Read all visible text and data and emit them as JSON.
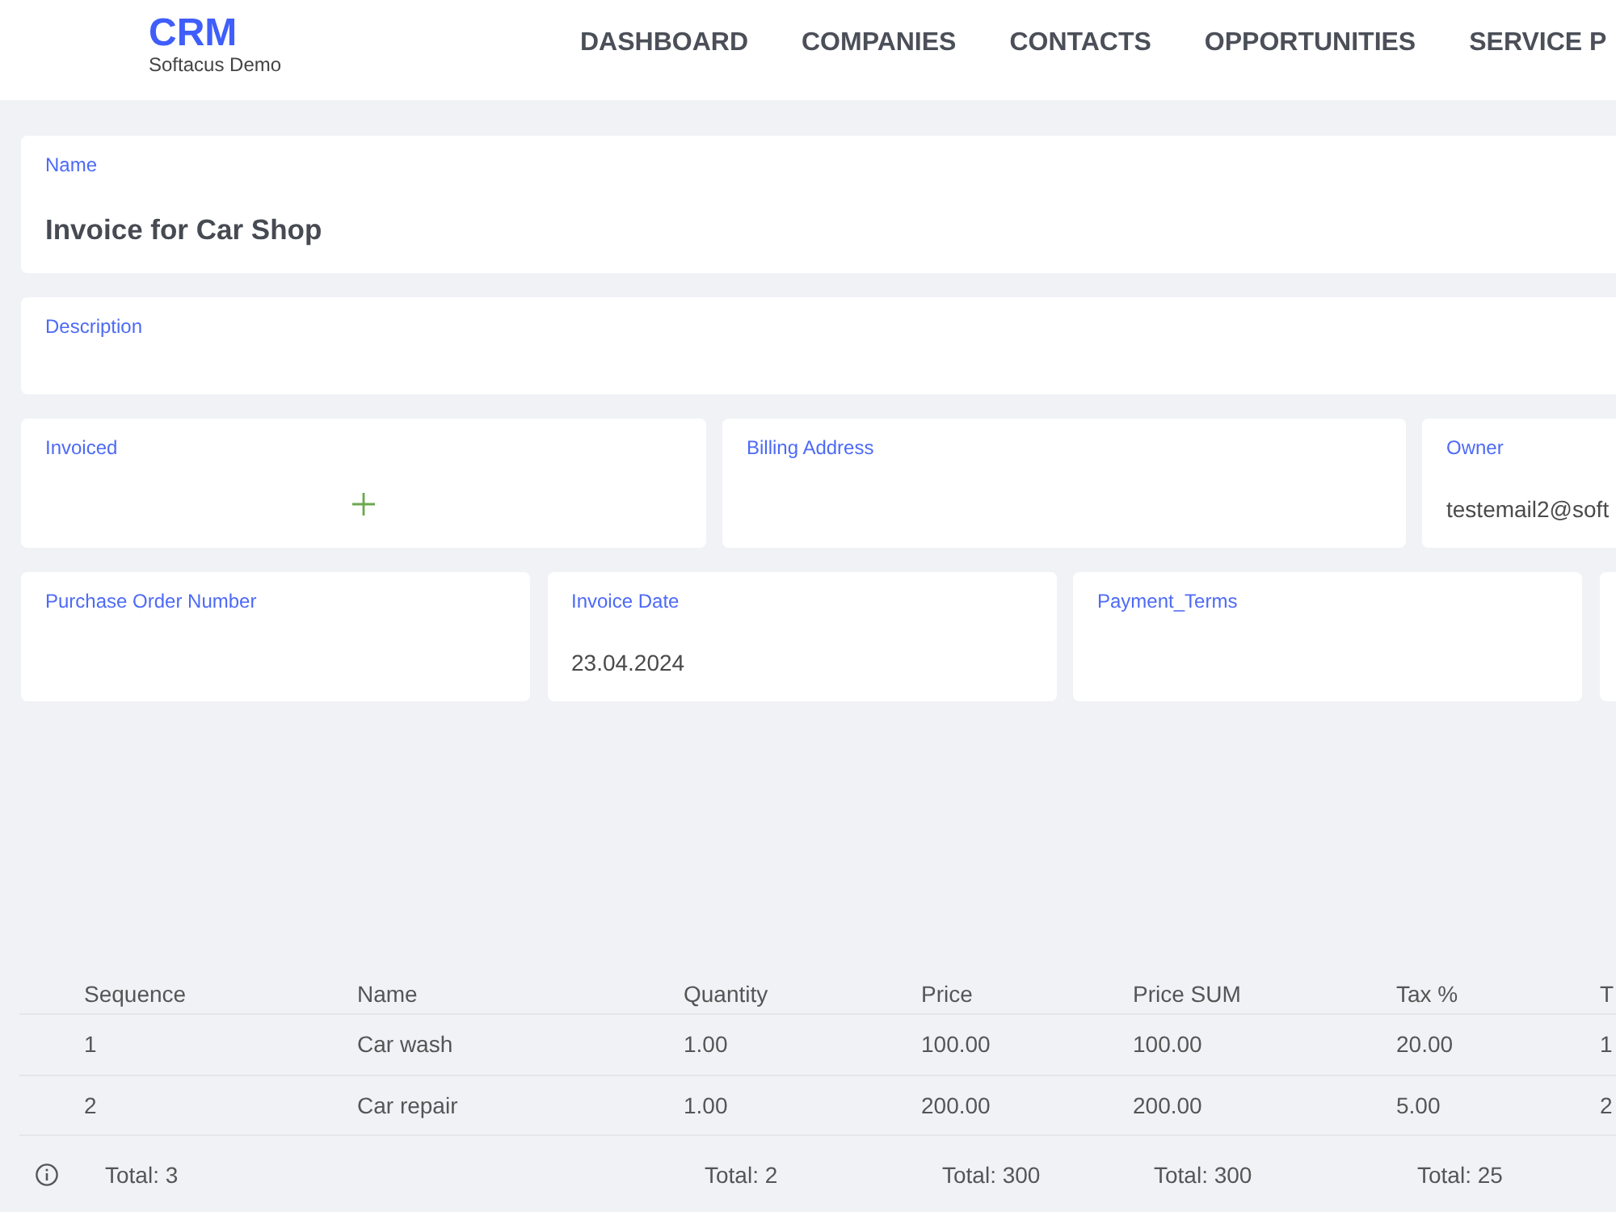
{
  "header": {
    "logo": "CRM",
    "subtitle": "Softacus Demo",
    "nav": [
      {
        "label": "DASHBOARD"
      },
      {
        "label": "COMPANIES"
      },
      {
        "label": "CONTACTS"
      },
      {
        "label": "OPPORTUNITIES"
      },
      {
        "label": "SERVICE P"
      }
    ]
  },
  "form": {
    "rows": [
      [
        {
          "kind": "title",
          "label": "Name",
          "value": "Invoice for Car Shop"
        }
      ],
      [
        {
          "kind": "text",
          "label": "Description"
        }
      ],
      [
        {
          "kind": "add",
          "label": "Invoiced"
        },
        {
          "kind": "text",
          "label": "Billing Address"
        },
        {
          "kind": "text",
          "label": "Owner",
          "value": "testemail2@soft"
        }
      ],
      [
        {
          "kind": "text",
          "label": "Purchase Order Number"
        },
        {
          "kind": "text",
          "label": "Invoice Date",
          "value": "23.04.2024"
        },
        {
          "kind": "text",
          "label": "Payment_Terms"
        },
        {
          "kind": "blank"
        }
      ]
    ]
  },
  "table": {
    "columns": [
      "Sequence",
      "Name",
      "Quantity",
      "Price",
      "Price SUM",
      "Tax %",
      "T"
    ],
    "rows": [
      [
        "1",
        "Car wash",
        "1.00",
        "100.00",
        "100.00",
        "20.00",
        "1"
      ],
      [
        "2",
        "Car repair",
        "1.00",
        "200.00",
        "200.00",
        "5.00",
        "2"
      ]
    ],
    "totals": {
      "sequence": "Total: 3",
      "quantity": "Total: 2",
      "price": "Total: 300",
      "price_sum": "Total: 300",
      "tax": "Total: 25"
    }
  }
}
